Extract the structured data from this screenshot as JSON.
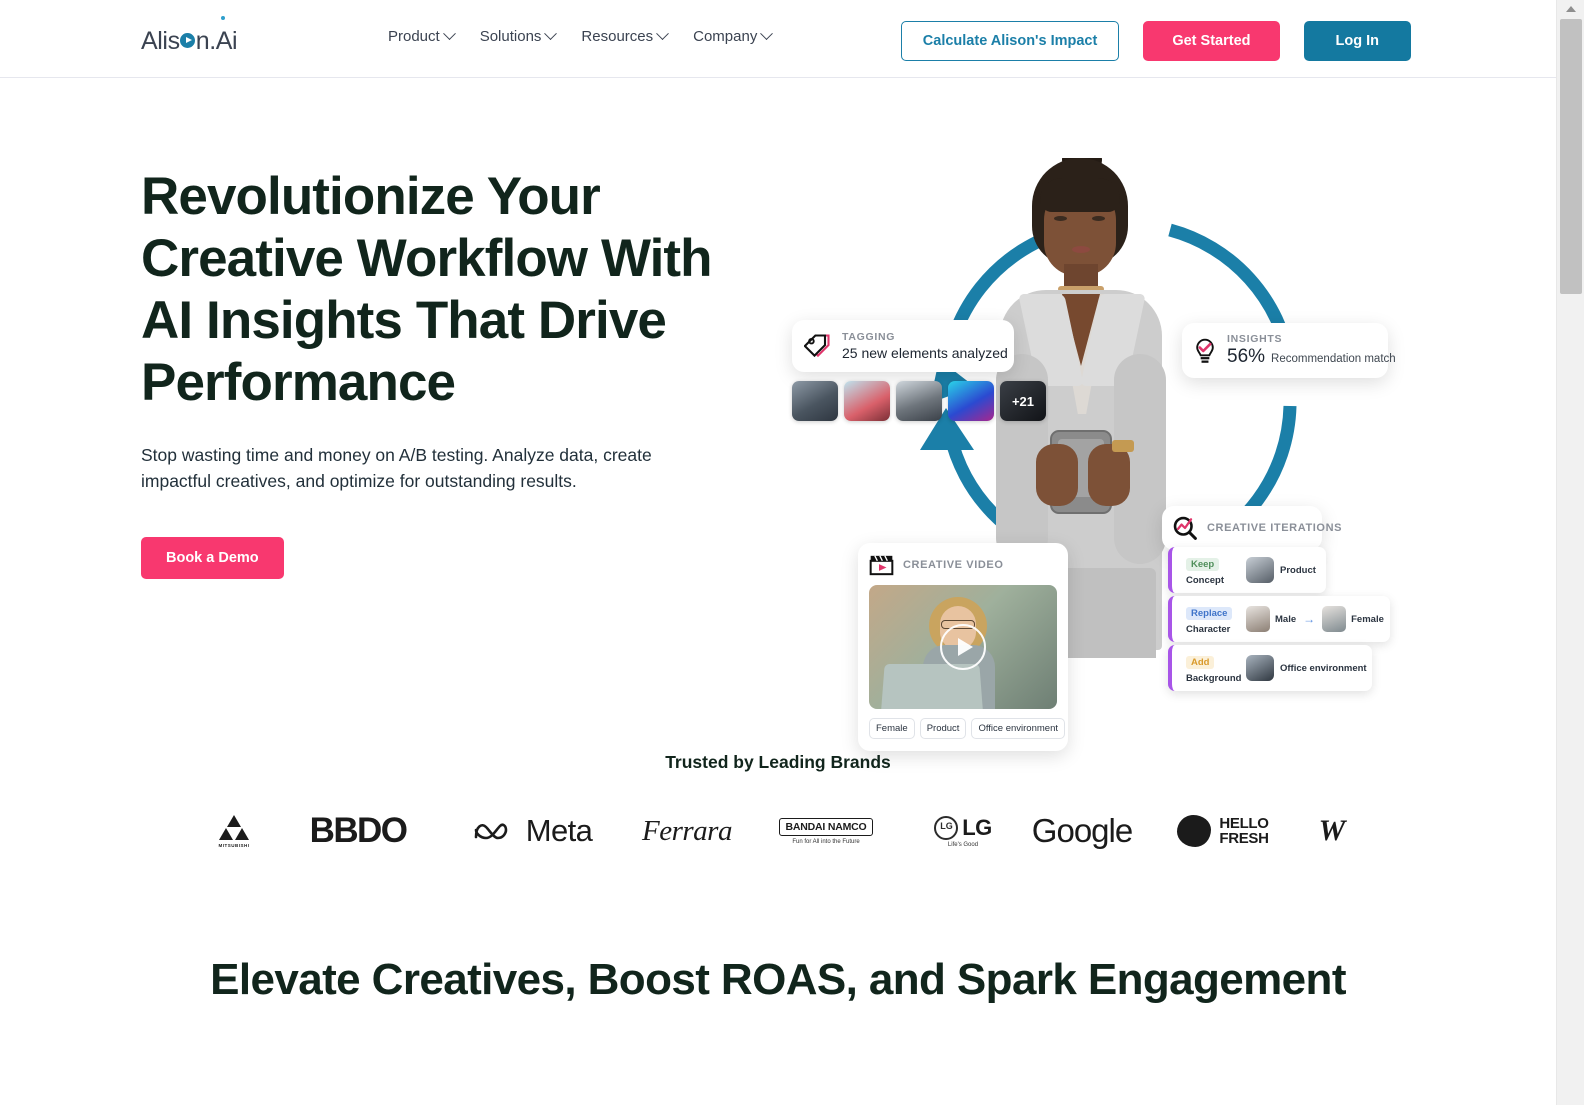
{
  "header": {
    "logo": {
      "part1": "Alis",
      "play_icon": "play-circle-icon",
      "part2": "n",
      "part3": ".Ai"
    },
    "nav": [
      {
        "label": "Product",
        "icon": "chevron-down-icon"
      },
      {
        "label": "Solutions",
        "icon": "chevron-down-icon"
      },
      {
        "label": "Resources",
        "icon": "chevron-down-icon"
      },
      {
        "label": "Company",
        "icon": "chevron-down-icon"
      }
    ],
    "actions": {
      "calculate": "Calculate Alison's Impact",
      "get_started": "Get Started",
      "log_in": "Log In"
    }
  },
  "hero": {
    "headline": "Revolutionize Your Creative Workflow With AI Insights That Drive Performance",
    "subtext": "Stop wasting time and money on A/B testing. Analyze data, create impactful creatives, and optimize for outstanding results.",
    "cta": "Book a Demo"
  },
  "art": {
    "tagging": {
      "icon": "tag-icon",
      "label": "TAGGING",
      "value": "25 new elements analyzed",
      "thumbnail_overflow": "+21"
    },
    "insights": {
      "icon": "lightbulb-icon",
      "label": "INSIGHTS",
      "percent": "56%",
      "note": "Recommendation match"
    },
    "creative_iterations": {
      "icon": "magnifier-chart-icon",
      "title": "CREATIVE ITERATIONS",
      "rows": [
        {
          "action": "Keep",
          "field": "Concept",
          "value": "Product"
        },
        {
          "action": "Replace",
          "field": "Character",
          "from": "Male",
          "arrow": "arrow-right-icon",
          "to": "Female"
        },
        {
          "action": "Add",
          "field": "Background",
          "value": "Office environment"
        }
      ]
    },
    "creative_video": {
      "icon": "clapperboard-icon",
      "title": "CREATIVE VIDEO",
      "play_icon": "play-icon",
      "chips": [
        "Female",
        "Product",
        "Office environment"
      ]
    }
  },
  "brands": {
    "title": "Trusted by Leading Brands",
    "items": [
      {
        "name": "MITSUBISHI",
        "wordmark": "MITSUBISHI"
      },
      {
        "name": "BBDO",
        "wordmark": "BBDO"
      },
      {
        "name": "Meta",
        "wordmark": "Meta"
      },
      {
        "name": "Ferrara",
        "wordmark": "Ferrara"
      },
      {
        "name": "BANDAI NAMCO",
        "wordmark": "BANDAI NAMCO",
        "tagline": "Fun for All into the Future"
      },
      {
        "name": "LG",
        "wordmark": "LG",
        "tagline": "Life's Good"
      },
      {
        "name": "Google",
        "wordmark": "Google"
      },
      {
        "name": "HELLO FRESH",
        "line1": "HELLO",
        "line2": "FRESH"
      },
      {
        "name": "W",
        "wordmark": "W"
      }
    ]
  },
  "section": {
    "title": "Elevate Creatives, Boost ROAS, and Spark Engagement"
  },
  "colors": {
    "pink": "#f8386f",
    "teal": "#1479a0",
    "dark_green": "#11251c",
    "arc_blue": "#1b7fa8",
    "purple_accent": "#a855e8"
  },
  "scrollbar": {
    "up_icon": "scroll-up-arrow-icon"
  }
}
